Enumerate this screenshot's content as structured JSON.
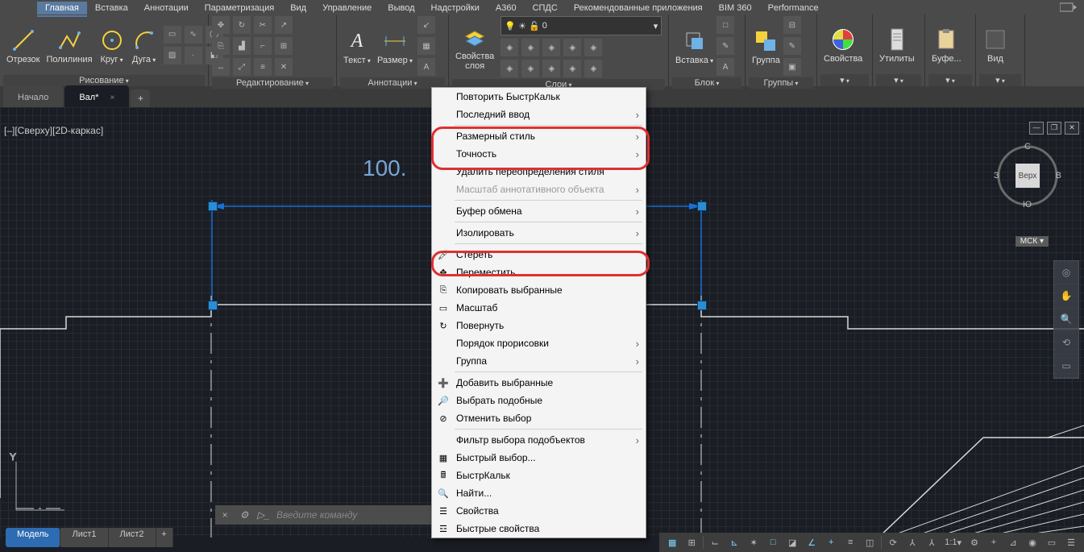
{
  "menubar": {
    "items": [
      "Главная",
      "Вставка",
      "Аннотации",
      "Параметризация",
      "Вид",
      "Управление",
      "Вывод",
      "Надстройки",
      "A360",
      "СПДС",
      "Рекомендованные приложения",
      "BIM 360",
      "Performance"
    ],
    "active": 0
  },
  "ribbon": {
    "draw": {
      "title": "Рисование",
      "big": [
        {
          "l": "Отрезок"
        },
        {
          "l": "Полилиния"
        },
        {
          "l": "Круг"
        },
        {
          "l": "Дуга"
        }
      ]
    },
    "edit": {
      "title": "Редактирование"
    },
    "anno": {
      "title": "Аннотации",
      "big": [
        {
          "l": "Текст"
        },
        {
          "l": "Размер"
        }
      ]
    },
    "layers": {
      "title": "Слои",
      "big": "Свойства\nслоя",
      "current": "0"
    },
    "block": {
      "title": "Блок",
      "big": "Вставка"
    },
    "groups": {
      "title": "Группы",
      "big": "Группа"
    },
    "props": {
      "title": "",
      "big": "Свойства"
    },
    "util": {
      "title": "",
      "big": "Утилиты"
    },
    "clip": {
      "title": "",
      "big": "Буфе..."
    },
    "view": {
      "title": "",
      "big": "Вид"
    }
  },
  "doctabs": {
    "items": [
      "Начало",
      "Вал*"
    ],
    "active": 1
  },
  "viewport": {
    "label": "[–][Сверху][2D-каркас]",
    "dim": "100.",
    "cube": {
      "t": "С",
      "r": "В",
      "b": "Ю",
      "l": "З",
      "f": "Верх"
    },
    "coord": "МСК"
  },
  "cmd": {
    "placeholder": "Введите команду"
  },
  "bottomtabs": {
    "items": [
      "Модель",
      "Лист1",
      "Лист2"
    ],
    "active": 0
  },
  "status": {
    "scale": "1:1"
  },
  "context": {
    "items": [
      {
        "t": "Повторить БыстрКальк"
      },
      {
        "t": "Последний ввод",
        "sub": true
      },
      {
        "sep": true
      },
      {
        "t": "Размерный стиль",
        "sub": true,
        "hl": true
      },
      {
        "t": "Точность",
        "sub": true,
        "hl": true
      },
      {
        "t": "Удалить переопределения стиля"
      },
      {
        "t": "Масштаб аннотативного объекта",
        "sub": true,
        "dis": true
      },
      {
        "sep": true
      },
      {
        "t": "Буфер обмена",
        "sub": true
      },
      {
        "sep": true
      },
      {
        "t": "Изолировать",
        "sub": true
      },
      {
        "sep": true
      },
      {
        "t": "Стереть",
        "i": "erase",
        "hl": true
      },
      {
        "t": "Переместить",
        "i": "move"
      },
      {
        "t": "Копировать выбранные",
        "i": "copy"
      },
      {
        "t": "Масштаб",
        "i": "scale"
      },
      {
        "t": "Повернуть",
        "i": "rotate"
      },
      {
        "t": "Порядок прорисовки",
        "sub": true
      },
      {
        "t": "Группа",
        "sub": true
      },
      {
        "sep": true
      },
      {
        "t": "Добавить выбранные",
        "i": "add"
      },
      {
        "t": "Выбрать подобные",
        "i": "similar"
      },
      {
        "t": "Отменить выбор",
        "i": "deselect"
      },
      {
        "sep": true
      },
      {
        "t": "Фильтр выбора подобъектов",
        "sub": true
      },
      {
        "t": "Быстрый выбор...",
        "i": "qselect"
      },
      {
        "t": "БыстрКальк",
        "i": "calc"
      },
      {
        "t": "Найти...",
        "i": "find"
      },
      {
        "t": "Свойства",
        "i": "props"
      },
      {
        "t": "Быстрые свойства",
        "i": "qprops"
      }
    ]
  }
}
